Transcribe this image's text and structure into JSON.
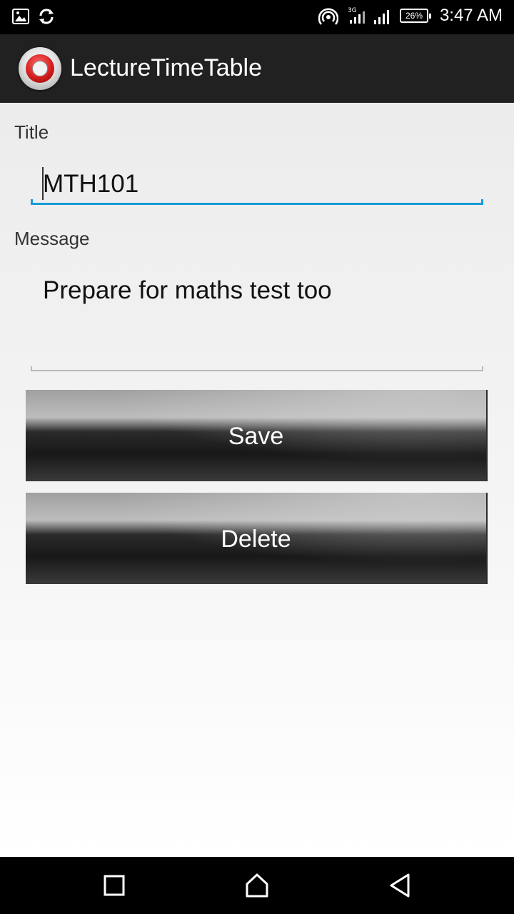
{
  "status_bar": {
    "time": "3:47 AM",
    "battery": "26%",
    "network": "3G",
    "icons": [
      "gallery-icon",
      "sync-icon",
      "hotspot-icon",
      "signal-3g-icon",
      "signal-icon",
      "battery-icon"
    ]
  },
  "action_bar": {
    "app_icon": "alarm-clock-icon",
    "title": "LectureTimeTable"
  },
  "form": {
    "title_label": "Title",
    "title_value": "MTH101",
    "message_label": "Message",
    "message_value": "Prepare for maths test too",
    "save_label": "Save",
    "delete_label": "Delete"
  },
  "nav_bar": {
    "icons": [
      "recent-apps-icon",
      "home-icon",
      "back-icon"
    ]
  },
  "colors": {
    "accent": "#1a9ad6",
    "action_bar": "#212121"
  }
}
